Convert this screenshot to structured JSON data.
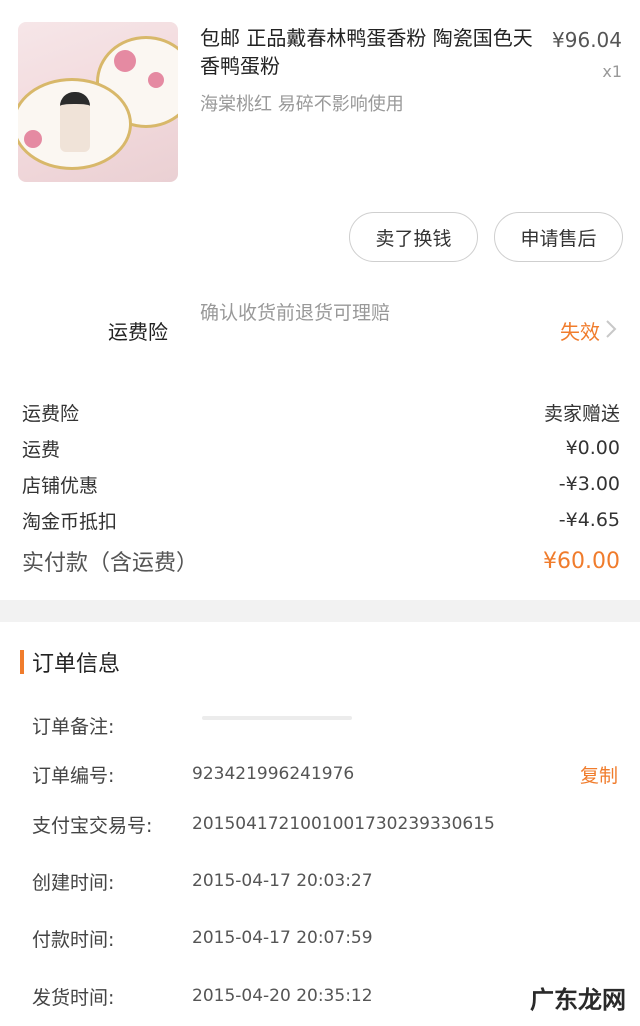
{
  "product": {
    "name": "包邮 正品戴春林鸭蛋香粉 陶瓷国色天香鸭蛋粉",
    "variant": "海棠桃红 易碎不影响使用",
    "price": "¥96.04",
    "quantity": "x1",
    "image_icon": "product-thumbnail"
  },
  "actions": {
    "sell": "卖了换钱",
    "after_sale": "申请售后"
  },
  "insurance": {
    "title": "运费险",
    "description": "确认收货前退货可理赔",
    "status": "失效",
    "icon": "chevron-right-icon"
  },
  "fees": [
    {
      "label": "运费险",
      "value": "卖家赠送"
    },
    {
      "label": "运费",
      "value": "¥0.00"
    },
    {
      "label": "店铺优惠",
      "value": "-¥3.00"
    },
    {
      "label": "淘金币抵扣",
      "value": "-¥4.65"
    }
  ],
  "total": {
    "label": "实付款（含运费）",
    "value": "¥60.00"
  },
  "order_info": {
    "title": "订单信息",
    "rows": [
      {
        "label": "订单备注:",
        "value": ""
      },
      {
        "label": "订单编号:",
        "value": "923421996241976",
        "action": "复制"
      },
      {
        "label": "支付宝交易号:",
        "value": "2015041721001001730239330615"
      },
      {
        "label": "创建时间:",
        "value": "2015-04-17 20:03:27"
      },
      {
        "label": "付款时间:",
        "value": "2015-04-17 20:07:59"
      },
      {
        "label": "发货时间:",
        "value": "2015-04-20 20:35:12"
      }
    ]
  },
  "watermark": "广东龙网",
  "colors": {
    "accent": "#f07c2c",
    "muted": "#999999",
    "divider": "#f2f2f2"
  }
}
